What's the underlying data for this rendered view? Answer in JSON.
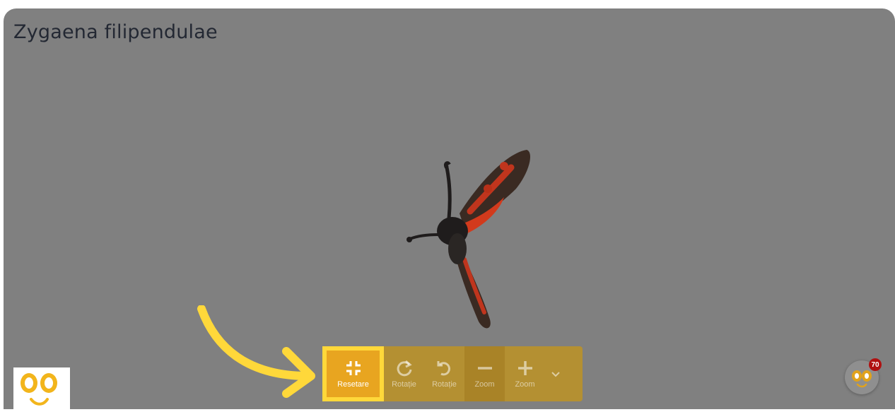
{
  "viewer": {
    "title": "Zygaena filipendulae"
  },
  "toolbar": {
    "buttons": [
      {
        "label": "Resetare",
        "icon": "compress-icon"
      },
      {
        "label": "Rotație",
        "icon": "rotate-clockwise-icon"
      },
      {
        "label": "Rotație",
        "icon": "rotate-counterclockwise-icon"
      },
      {
        "label": "Zoom",
        "icon": "minus-icon"
      },
      {
        "label": "Zoom",
        "icon": "plus-icon"
      }
    ],
    "more_icon": "chevron-down-icon"
  },
  "notifications": {
    "count": "70"
  },
  "colors": {
    "viewer_bg": "#808080",
    "toolbar_bg": "#c89614",
    "active_button": "#e8a520",
    "highlight": "#ffd83a",
    "badge": "#b01010"
  }
}
